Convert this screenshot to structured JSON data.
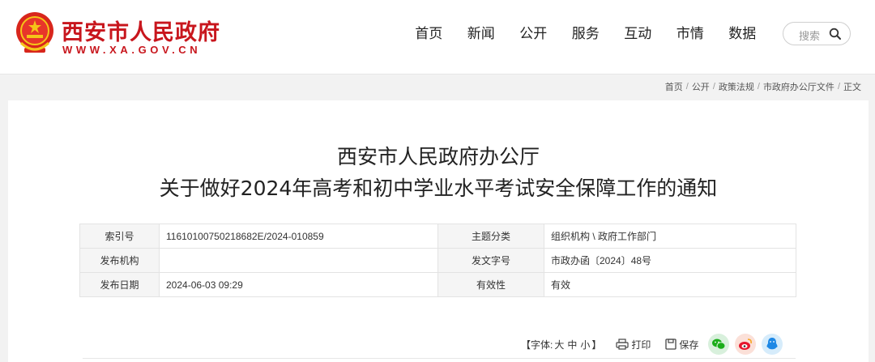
{
  "header": {
    "site_title": "西安市人民政府",
    "site_url": "WWW.XA.GOV.CN",
    "nav": [
      "首页",
      "新闻",
      "公开",
      "服务",
      "互动",
      "市情",
      "数据"
    ],
    "search_placeholder": "搜索"
  },
  "breadcrumb": {
    "items": [
      "首页",
      "公开",
      "政策法规",
      "市政府办公厅文件",
      "正文"
    ],
    "separator": "/"
  },
  "article": {
    "title_line1": "西安市人民政府办公厅",
    "title_line2": "关于做好2024年高考和初中学业水平考试安全保障工作的通知"
  },
  "meta": {
    "rows": [
      {
        "label1": "索引号",
        "value1": "11610100750218682E/2024-010859",
        "label2": "主题分类",
        "value2": "组织机构 \\ 政府工作部门"
      },
      {
        "label1": "发布机构",
        "value1": "",
        "label2": "发文字号",
        "value2": "市政办函〔2024〕48号"
      },
      {
        "label1": "发布日期",
        "value1": "2024-06-03 09:29",
        "label2": "有效性",
        "value2": "有效"
      }
    ]
  },
  "tools": {
    "font_prefix": "【字体:",
    "font_large": "大",
    "font_medium": "中",
    "font_small": "小",
    "font_suffix": "】",
    "print_label": "打印",
    "save_label": "保存"
  },
  "colors": {
    "brand_red": "#c8161d",
    "wechat": "#1aad19",
    "weibo": "#e6162d",
    "qq": "#1e88e5"
  }
}
